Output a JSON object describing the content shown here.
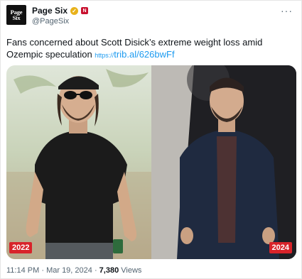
{
  "account": {
    "display_name": "Page Six",
    "handle": "@PageSix",
    "avatar_text_line1": "Page",
    "avatar_text_line2": "Six",
    "verified_icon": "verified-badge-icon",
    "affiliate_icon": "affiliate-badge-icon",
    "badge_color": "#e8b21a",
    "affiliate_color": "#c8102e"
  },
  "more_icon": "more-options-icon",
  "tweet": {
    "text": "Fans concerned about Scott Disick’s extreme weight loss amid Ozempic speculation ",
    "link_prefix": "https://",
    "link_text": "trib.al/626bwFf"
  },
  "media": {
    "left_photo": {
      "year": "2022"
    },
    "right_photo": {
      "year": "2024"
    },
    "tag_color": "#d8232a"
  },
  "footer": {
    "time": "11:14 PM",
    "separator": " · ",
    "date": "Mar 19, 2024",
    "views_count": "7,380",
    "views_label": " Views"
  },
  "colors": {
    "link": "#1d9bf0",
    "secondary_text": "#536471"
  }
}
